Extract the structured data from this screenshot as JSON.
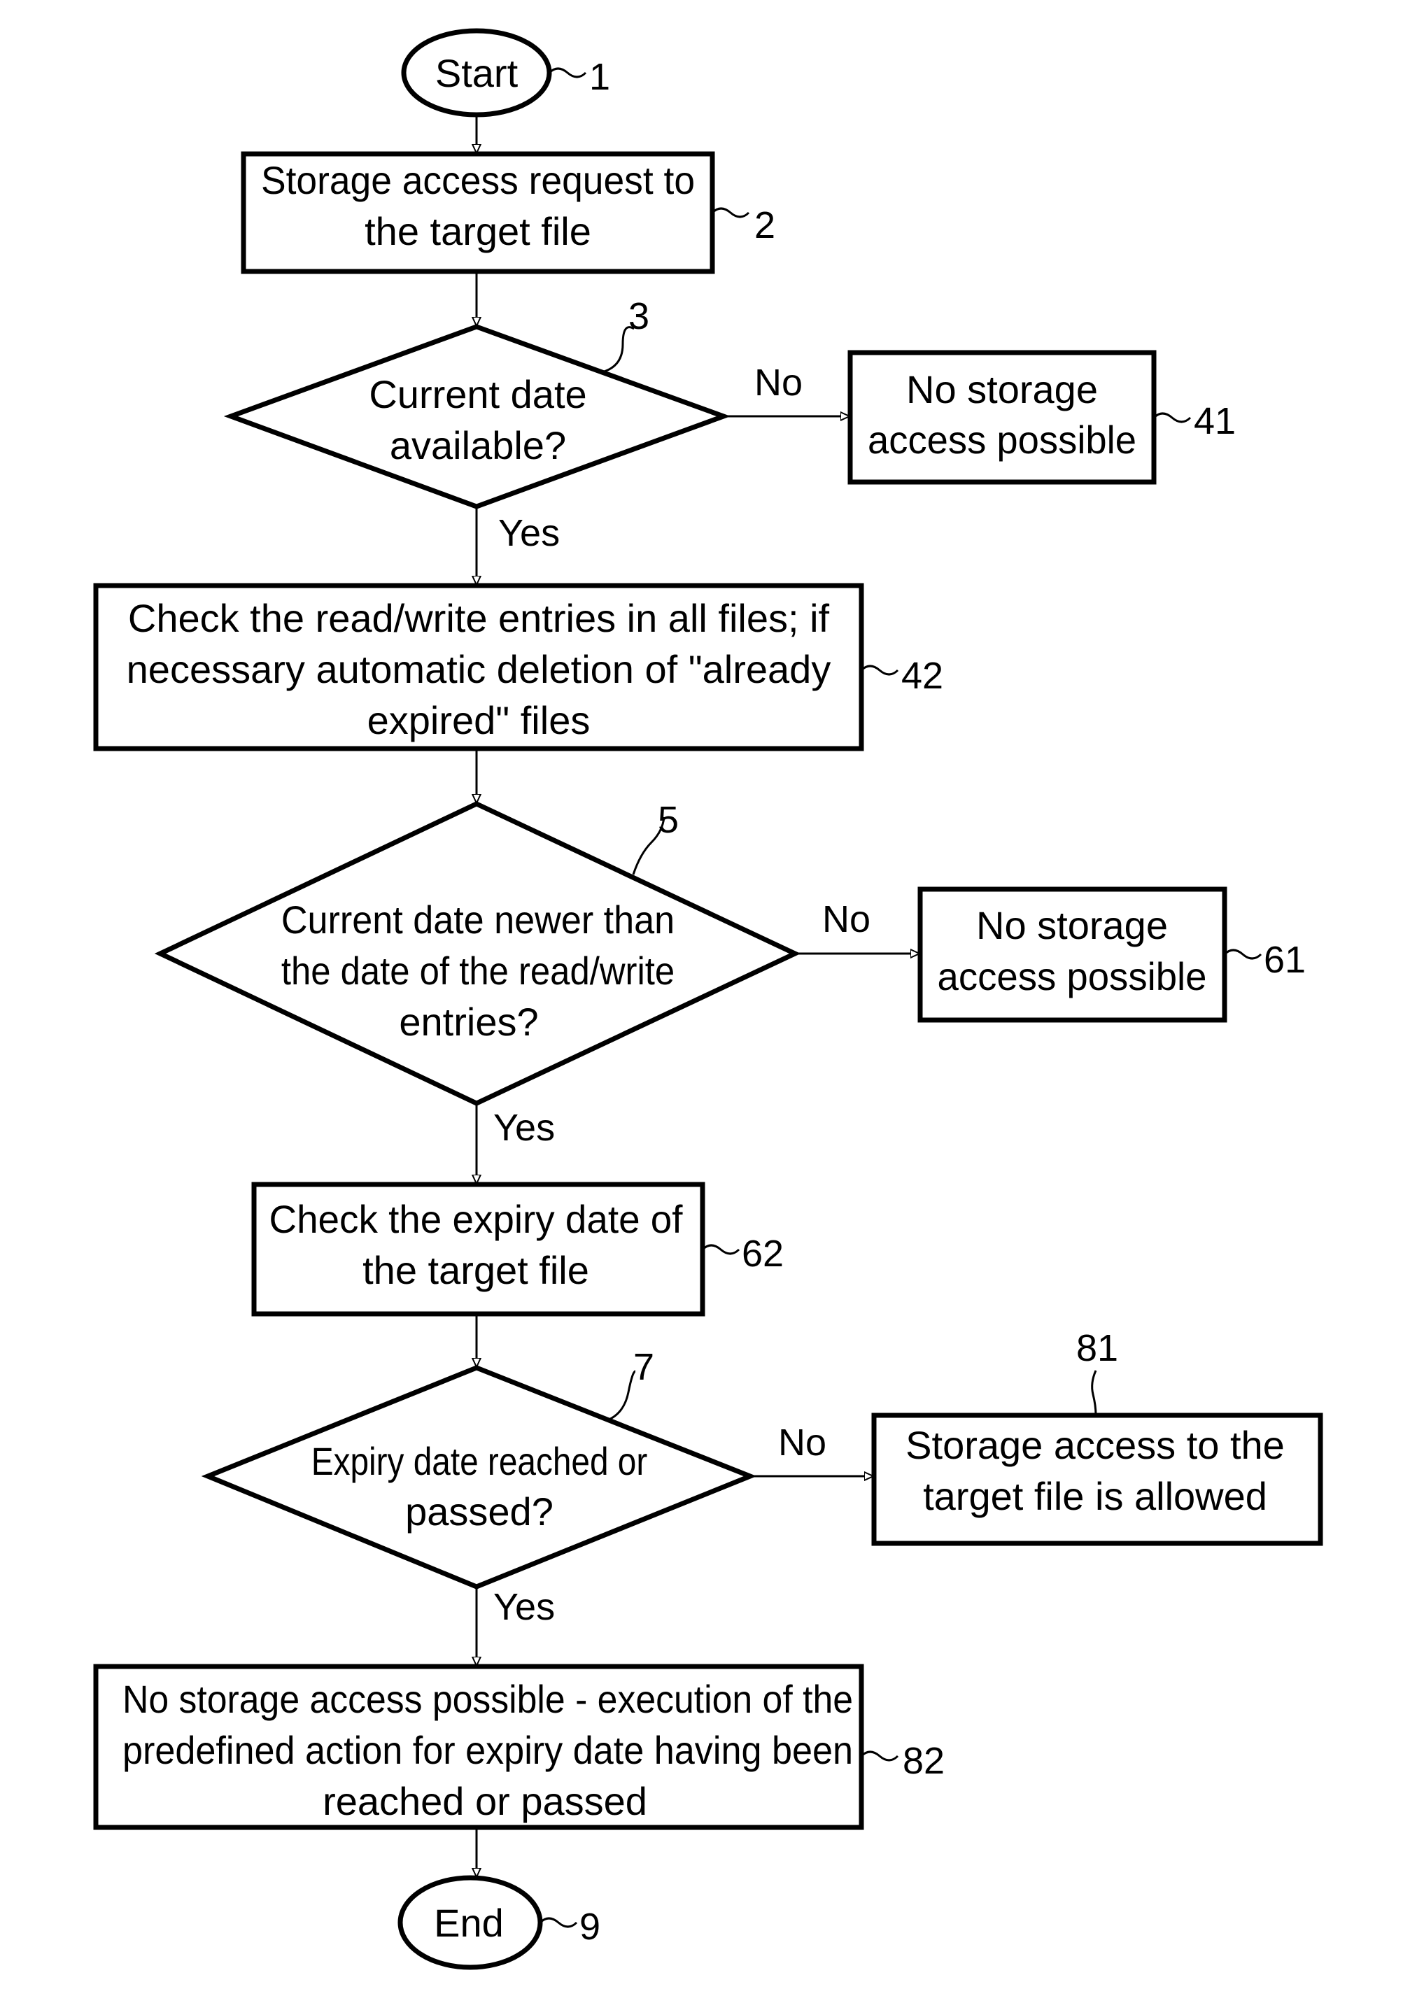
{
  "diagram": {
    "type": "flowchart",
    "nodes": {
      "start": {
        "ref": "1",
        "shape": "terminal",
        "lines": [
          "Start"
        ]
      },
      "request": {
        "ref": "2",
        "shape": "process",
        "lines": [
          "Storage access request to",
          "the target file"
        ]
      },
      "date_available": {
        "ref": "3",
        "shape": "decision",
        "lines": [
          "Current date",
          "available?"
        ]
      },
      "no_access_1": {
        "ref": "41",
        "shape": "process",
        "lines": [
          "No storage",
          "access possible"
        ]
      },
      "check_entries": {
        "ref": "42",
        "shape": "process",
        "lines": [
          "Check the read/write entries in all files; if",
          "necessary automatic deletion of \"already",
          "expired\" files"
        ]
      },
      "date_newer": {
        "ref": "5",
        "shape": "decision",
        "lines": [
          "Current date newer than",
          "the date of the read/write",
          "entries?"
        ]
      },
      "no_access_2": {
        "ref": "61",
        "shape": "process",
        "lines": [
          "No storage",
          "access possible"
        ]
      },
      "check_expiry": {
        "ref": "62",
        "shape": "process",
        "lines": [
          "Check the expiry date of",
          "the target file"
        ]
      },
      "expiry_reached": {
        "ref": "7",
        "shape": "decision",
        "lines": [
          "Expiry date reached or",
          "passed?"
        ]
      },
      "access_allowed": {
        "ref": "81",
        "shape": "process",
        "lines": [
          "Storage access to the",
          "target file is allowed"
        ]
      },
      "predefined_action": {
        "ref": "82",
        "shape": "process",
        "lines": [
          "No storage access possible - execution of the",
          "predefined action for expiry date having been",
          "reached or passed"
        ]
      },
      "end": {
        "ref": "9",
        "shape": "terminal",
        "lines": [
          "End"
        ]
      }
    },
    "edges": [
      {
        "from": "start",
        "to": "request",
        "label": ""
      },
      {
        "from": "request",
        "to": "date_available",
        "label": ""
      },
      {
        "from": "date_available",
        "to": "no_access_1",
        "label": "No"
      },
      {
        "from": "date_available",
        "to": "check_entries",
        "label": "Yes"
      },
      {
        "from": "check_entries",
        "to": "date_newer",
        "label": ""
      },
      {
        "from": "date_newer",
        "to": "no_access_2",
        "label": "No"
      },
      {
        "from": "date_newer",
        "to": "check_expiry",
        "label": "Yes"
      },
      {
        "from": "check_expiry",
        "to": "expiry_reached",
        "label": ""
      },
      {
        "from": "expiry_reached",
        "to": "access_allowed",
        "label": "No"
      },
      {
        "from": "expiry_reached",
        "to": "predefined_action",
        "label": "Yes"
      },
      {
        "from": "predefined_action",
        "to": "end",
        "label": ""
      }
    ],
    "labels": {
      "yes": "Yes",
      "no": "No"
    }
  }
}
